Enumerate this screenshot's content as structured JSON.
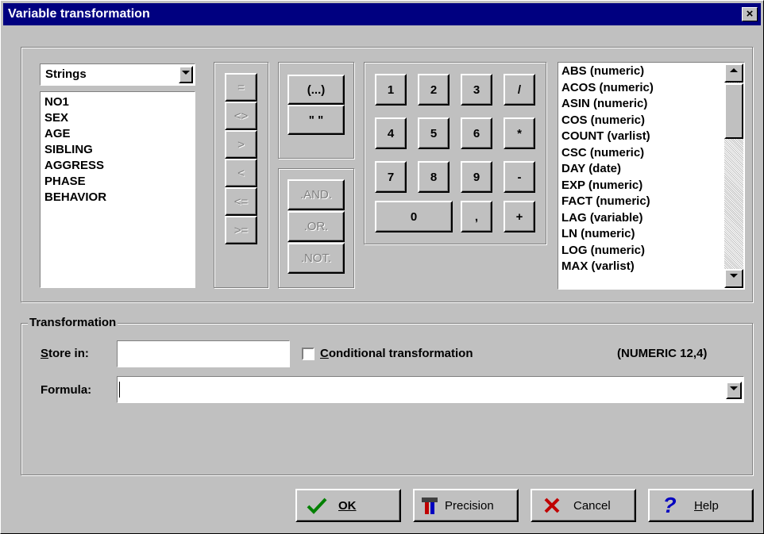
{
  "window": {
    "title": "Variable transformation",
    "close": "×"
  },
  "variables": {
    "type_selected": "Strings",
    "items": [
      "NO1",
      "SEX",
      "AGE",
      "SIBLING",
      "AGGRESS",
      "PHASE",
      "BEHAVIOR"
    ]
  },
  "comparison_buttons": [
    "=",
    "<>",
    ">",
    "<",
    "<=",
    ">="
  ],
  "paren_buttons": [
    "(...)",
    "\" \""
  ],
  "logic_buttons": [
    ".AND.",
    ".OR.",
    ".NOT."
  ],
  "keypad": {
    "row1": [
      "1",
      "2",
      "3",
      "/"
    ],
    "row2": [
      "4",
      "5",
      "6",
      "*"
    ],
    "row3": [
      "7",
      "8",
      "9",
      "-"
    ],
    "row4": [
      "0",
      ",",
      "+"
    ]
  },
  "functions": [
    "ABS (numeric)",
    "ACOS (numeric)",
    "ASIN (numeric)",
    "COS (numeric)",
    "COUNT (varlist)",
    "CSC (numeric)",
    "DAY (date)",
    "EXP (numeric)",
    "FACT (numeric)",
    "LAG (variable)",
    "LN (numeric)",
    "LOG (numeric)",
    "MAX (varlist)"
  ],
  "transformation": {
    "group_label": "Transformation",
    "store_in_label": "Store in:",
    "store_in_value": "",
    "conditional_label": "Conditional transformation",
    "conditional_checked": false,
    "type_info": "(NUMERIC 12,4)",
    "formula_label": "Formula:",
    "formula_value": ""
  },
  "buttons": {
    "ok": "OK",
    "precision": "Precision",
    "cancel": "Cancel",
    "help": "Help"
  },
  "icons": {
    "ok": "checkmark-icon",
    "precision": "tools-icon",
    "cancel": "x-icon",
    "help": "question-icon"
  }
}
